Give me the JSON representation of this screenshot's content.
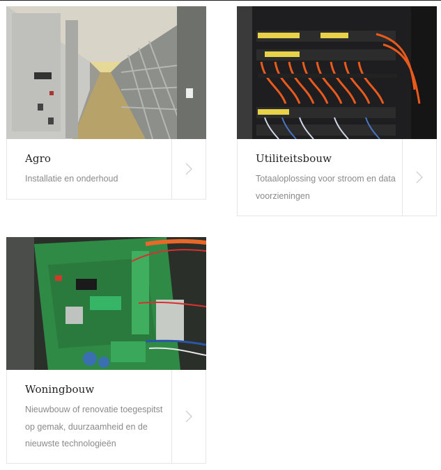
{
  "cards": [
    {
      "title": "Agro",
      "description": "Installatie en onderhoud",
      "image": "stable-corridor-photo",
      "arrow_icon": "chevron-right-icon"
    },
    {
      "title": "Utiliteitsbouw",
      "description": "Totaaloplossing voor stroom en data voorzieningen",
      "image": "network-patch-panel-photo",
      "arrow_icon": "chevron-right-icon"
    },
    {
      "title": "Woningbouw",
      "description": "Nieuwbouw of renovatie toegespitst op gemak, duurzaamheid en de nieuwste technologieën",
      "image": "circuit-board-photo",
      "arrow_icon": "chevron-right-icon"
    }
  ],
  "colors": {
    "border": "#e6e6e6",
    "title": "#222222",
    "description": "#8a8a8a",
    "chevron": "#cfcfcf"
  }
}
